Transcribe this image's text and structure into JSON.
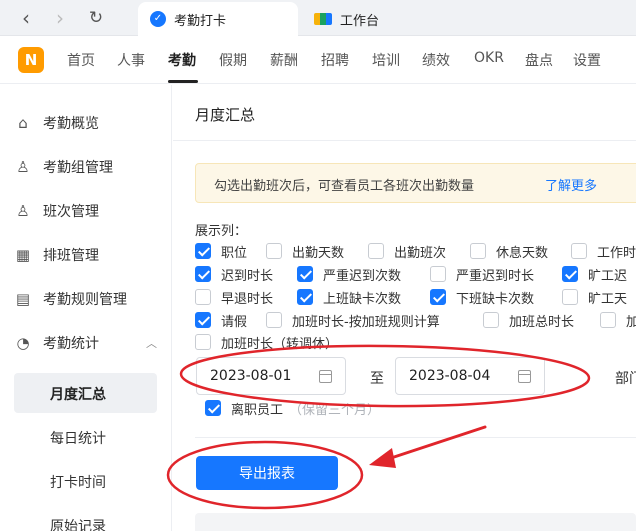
{
  "browser": {
    "tabs": [
      {
        "label": "考勤打卡",
        "active": true,
        "icon": "shield-icon"
      },
      {
        "label": "工作台",
        "active": false,
        "icon": "workbench-icon"
      }
    ]
  },
  "topnav": {
    "logo_letter": "N",
    "items": [
      "首页",
      "人事",
      "考勤",
      "假期",
      "薪酬",
      "招聘",
      "培训",
      "绩效",
      "OKR",
      "盘点",
      "设置"
    ],
    "active_index": 2
  },
  "sidebar": {
    "items": [
      {
        "label": "考勤概览",
        "icon": "home-icon"
      },
      {
        "label": "考勤组管理",
        "icon": "user-group-icon"
      },
      {
        "label": "班次管理",
        "icon": "shift-icon"
      },
      {
        "label": "排班管理",
        "icon": "calendar-icon"
      },
      {
        "label": "考勤规则管理",
        "icon": "rules-icon"
      },
      {
        "label": "考勤统计",
        "icon": "stats-icon",
        "expanded": true
      }
    ],
    "subitems": [
      "月度汇总",
      "每日统计",
      "打卡时间",
      "原始记录"
    ],
    "active_sub": 0
  },
  "main": {
    "title": "月度汇总",
    "notice_text": "勾选出勤班次后，可查看员工各班次出勤数量",
    "notice_link": "了解更多",
    "columns_label": "展示列：",
    "options": [
      {
        "label": "职位",
        "checked": true
      },
      {
        "label": "出勤天数",
        "checked": false
      },
      {
        "label": "出勤班次",
        "checked": false
      },
      {
        "label": "休息天数",
        "checked": false
      },
      {
        "label": "工作时",
        "checked": false
      },
      {
        "label": "迟到时长",
        "checked": true
      },
      {
        "label": "严重迟到次数",
        "checked": true
      },
      {
        "label": "严重迟到时长",
        "checked": false
      },
      {
        "label": "旷工迟",
        "checked": true
      },
      {
        "label": "早退时长",
        "checked": false
      },
      {
        "label": "上班缺卡次数",
        "checked": true
      },
      {
        "label": "下班缺卡次数",
        "checked": true
      },
      {
        "label": "旷工天",
        "checked": false
      },
      {
        "label": "请假",
        "checked": true
      },
      {
        "label": "加班时长-按加班规则计算",
        "checked": false
      },
      {
        "label": "加班总时长",
        "checked": false
      },
      {
        "label": "加",
        "checked": false
      },
      {
        "label": "加班时长（转调休）",
        "checked": false
      }
    ],
    "date_start": "2023-08-01",
    "date_to": "至",
    "date_end": "2023-08-04",
    "dept_label": "部门",
    "resigned_label": "离职员工",
    "resigned_hint": "（保留三个月）",
    "resigned_checked": true,
    "export_label": "导出报表"
  },
  "colors": {
    "accent": "#1677ff",
    "annotation": "#e0252b",
    "logo": "#ff9b00"
  }
}
